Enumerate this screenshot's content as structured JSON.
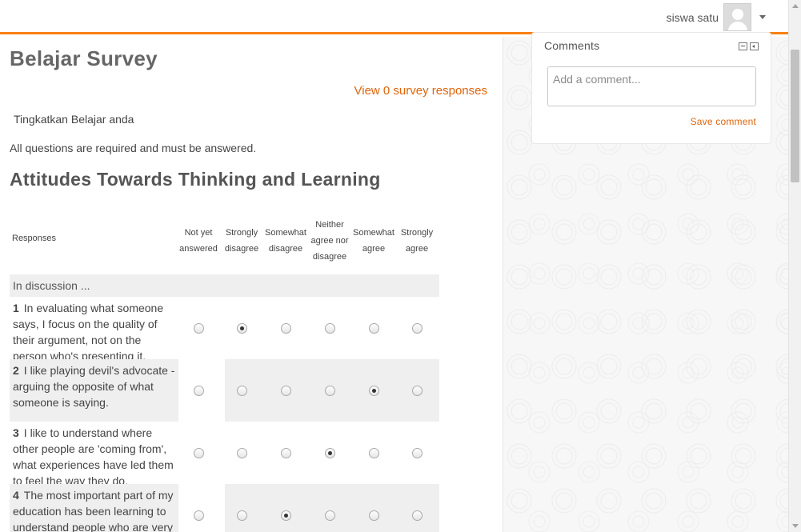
{
  "header": {
    "user_name": "siswa satu",
    "avatar_icon": "user-avatar-icon",
    "menu_icon": "chevron-down-icon",
    "accent_color": "#f98012"
  },
  "main": {
    "title": "Belajar Survey",
    "responses_link": "View 0 survey responses",
    "intro": "Tingkatkan Belajar anda",
    "required_note": "All questions are required and must be answered.",
    "section_title": "Attitudes Towards Thinking and Learning",
    "table": {
      "responses_label": "Responses",
      "columns": [
        {
          "label": "Not yet answered"
        },
        {
          "label": "Strongly disagree"
        },
        {
          "label": "Somewhat disagree"
        },
        {
          "label": "Neither agree nor disagree"
        },
        {
          "label": "Somewhat agree"
        },
        {
          "label": "Strongly agree"
        }
      ],
      "group_label": "In discussion ...",
      "questions": [
        {
          "num": "1",
          "text": "In evaluating what someone says, I focus on the quality of their argument, not on the person who's presenting it.",
          "selected": "Strongly disagree"
        },
        {
          "num": "2",
          "text": "I like playing devil's advocate - arguing the opposite of what someone is saying.",
          "selected": "Somewhat agree"
        },
        {
          "num": "3",
          "text": "I like to understand where other people are 'coming from', what experiences have led them to feel the way they do.",
          "selected": "Neither agree nor disagree"
        },
        {
          "num": "4",
          "text": "The most important part of my education has been learning to understand people who are very different to me.",
          "selected": "Somewhat disagree"
        }
      ]
    }
  },
  "sidebar": {
    "comments_title": "Comments",
    "hide_icon": "minus-icon",
    "dock_icon": "dock-left-icon",
    "comment_placeholder": "Add a comment...",
    "save_comment": "Save comment"
  }
}
